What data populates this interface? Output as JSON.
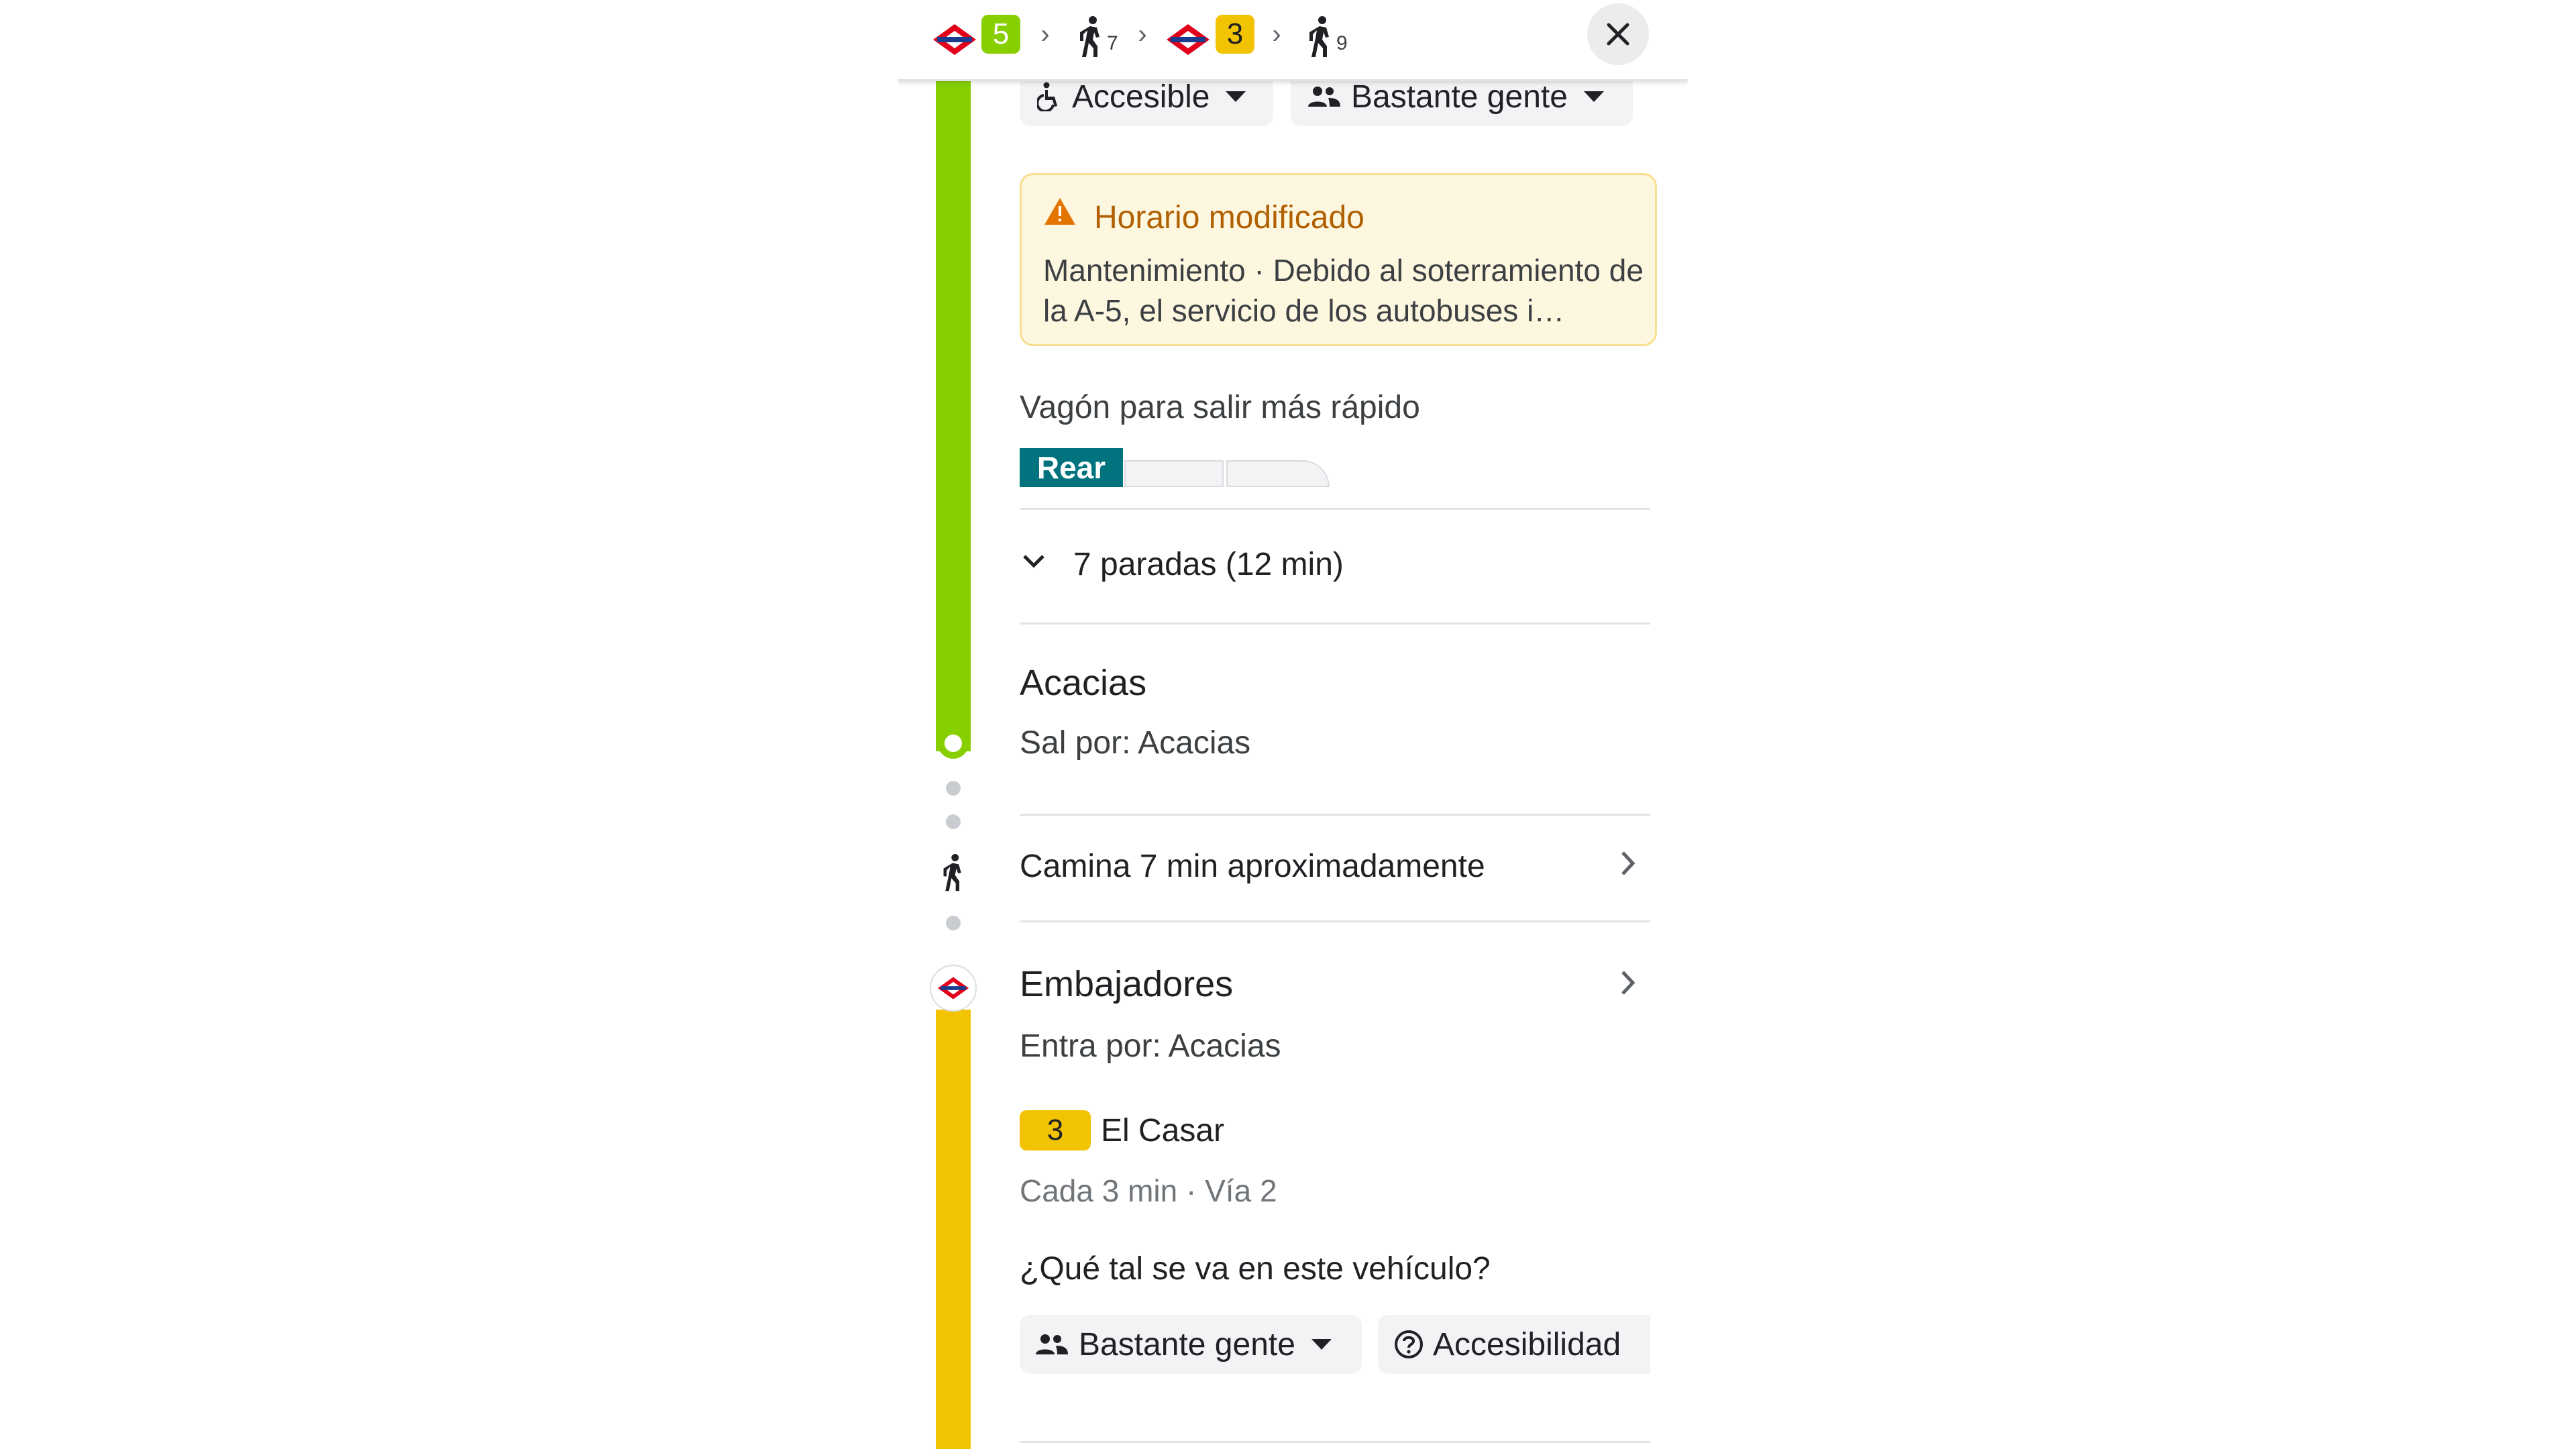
{
  "top_bar": {
    "leg1_line": "5",
    "walk1_minutes": "7",
    "leg2_line": "3",
    "walk2_minutes": "9",
    "chevron": "›",
    "close_icon": "close-icon"
  },
  "leg1": {
    "chips": {
      "accessible": "Accesible",
      "crowding": "Bastante gente"
    },
    "alert": {
      "title": "Horario modificado",
      "body": "Mantenimiento · Debido al soterramiento de la A-5, el servicio de los autobuses i…"
    },
    "wagon_heading": "Vagón para salir más rápido",
    "wagon_label": "Rear",
    "stops_label": "7 paradas (12 min)",
    "arrival_station": "Acacias",
    "exit_label": "Sal por: Acacias"
  },
  "walk": {
    "label": "Camina 7 min aproximadamente"
  },
  "leg2": {
    "station": "Embajadores",
    "enter_label": "Entra por: Acacias",
    "line_number": "3",
    "destination": "El Casar",
    "frequency": "Cada 3 min · Vía 2",
    "question": "¿Qué tal se va en este vehículo?",
    "chips": {
      "crowding": "Bastante gente",
      "accessibility": "Accesibilidad"
    }
  },
  "colors": {
    "line5": "#87cf00",
    "line3": "#f2c300",
    "alert_title": "#b06000",
    "rear_wagon": "#00737f"
  }
}
